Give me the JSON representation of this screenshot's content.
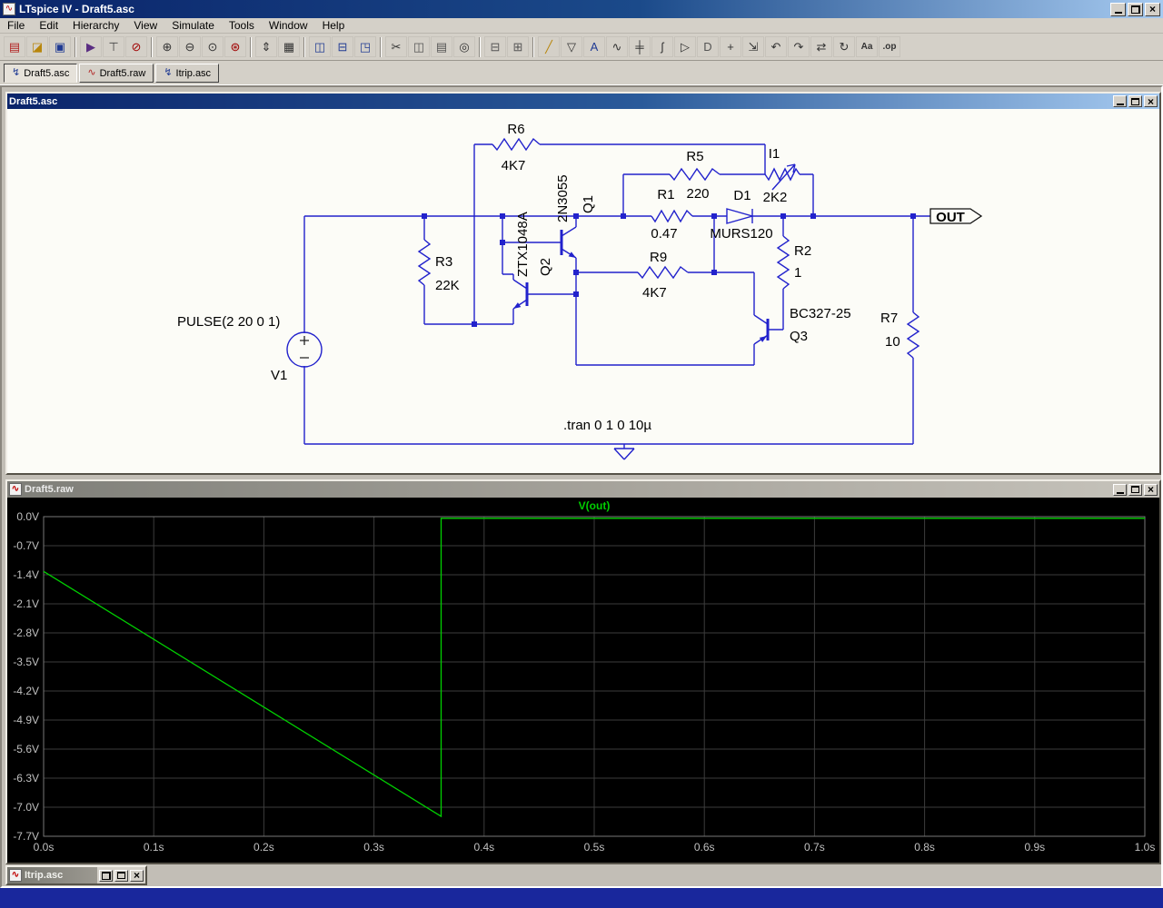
{
  "app": {
    "title": "LTspice IV - Draft5.asc"
  },
  "menu": [
    "File",
    "Edit",
    "Hierarchy",
    "View",
    "Simulate",
    "Tools",
    "Window",
    "Help"
  ],
  "toolbar": [
    {
      "name": "new-schematic",
      "glyph": "▤",
      "color": "#b22222"
    },
    {
      "name": "open-file",
      "glyph": "◪",
      "color": "#b8860b"
    },
    {
      "name": "save",
      "glyph": "▣",
      "color": "#1f3a93"
    },
    {
      "type": "sep"
    },
    {
      "name": "run",
      "glyph": "▶",
      "color": "#5a2d82"
    },
    {
      "name": "control-panel",
      "glyph": "⊤",
      "color": "#444444"
    },
    {
      "name": "halt",
      "glyph": "⊘",
      "color": "#a00000"
    },
    {
      "type": "sep"
    },
    {
      "name": "zoom-in",
      "glyph": "⊕",
      "color": "#333333"
    },
    {
      "name": "zoom-back",
      "glyph": "⊖",
      "color": "#333333"
    },
    {
      "name": "zoom-area",
      "glyph": "⊙",
      "color": "#333333"
    },
    {
      "name": "zoom-extents",
      "glyph": "⊛",
      "color": "#a00000"
    },
    {
      "type": "sep"
    },
    {
      "name": "autorange",
      "glyph": "⇕",
      "color": "#333333"
    },
    {
      "name": "plot-settings",
      "glyph": "▦",
      "color": "#333333"
    },
    {
      "type": "sep"
    },
    {
      "name": "tile-vertical",
      "glyph": "◫",
      "color": "#1f3a93"
    },
    {
      "name": "tile-horizontal",
      "glyph": "⊟",
      "color": "#1f3a93"
    },
    {
      "name": "cascade",
      "glyph": "◳",
      "color": "#1f3a93"
    },
    {
      "type": "sep"
    },
    {
      "name": "cut",
      "glyph": "✂",
      "color": "#333333"
    },
    {
      "name": "copy",
      "glyph": "◫",
      "color": "#555555"
    },
    {
      "name": "paste",
      "glyph": "▤",
      "color": "#555555"
    },
    {
      "name": "find",
      "glyph": "◎",
      "color": "#333333"
    },
    {
      "type": "sep"
    },
    {
      "name": "print",
      "glyph": "⊟",
      "color": "#555555"
    },
    {
      "name": "print-preview",
      "glyph": "⊞",
      "color": "#555555"
    },
    {
      "type": "sep"
    },
    {
      "name": "wire",
      "glyph": "╱",
      "color": "#b8860b"
    },
    {
      "name": "ground",
      "glyph": "▽",
      "color": "#333333"
    },
    {
      "name": "label-net",
      "glyph": "A",
      "color": "#1f3a93"
    },
    {
      "name": "resistor",
      "glyph": "∿",
      "color": "#333333"
    },
    {
      "name": "capacitor",
      "glyph": "╪",
      "color": "#333333"
    },
    {
      "name": "inductor",
      "glyph": "ʃ",
      "color": "#333333"
    },
    {
      "name": "diode",
      "glyph": "▷",
      "color": "#333333"
    },
    {
      "name": "component",
      "glyph": "D",
      "color": "#555555"
    },
    {
      "name": "move",
      "glyph": "+",
      "color": "#333333"
    },
    {
      "name": "drag",
      "glyph": "⇲",
      "color": "#333333"
    },
    {
      "name": "undo",
      "glyph": "↶",
      "color": "#333333"
    },
    {
      "name": "redo",
      "glyph": "↷",
      "color": "#333333"
    },
    {
      "name": "mirror",
      "glyph": "⇄",
      "color": "#333333"
    },
    {
      "name": "rotate",
      "glyph": "↻",
      "color": "#333333"
    },
    {
      "name": "text",
      "glyph": "Aa",
      "color": "#333333"
    },
    {
      "name": "spice-directive",
      "glyph": ".op",
      "color": "#333333"
    }
  ],
  "tabs": [
    {
      "label": "Draft5.asc",
      "icon": "schematic-icon",
      "glyph": "↯",
      "color": "#1f3a93",
      "active": true
    },
    {
      "label": "Draft5.raw",
      "icon": "waveform-icon",
      "glyph": "∿",
      "color": "#b22222",
      "active": false
    },
    {
      "label": "Itrip.asc",
      "icon": "schematic-icon",
      "glyph": "↯",
      "color": "#1f3a93",
      "active": false
    }
  ],
  "windows": {
    "schematic": {
      "title": "Draft5.asc"
    },
    "waveform": {
      "title": "Draft5.raw"
    },
    "minimized": {
      "title": "Itrip.asc"
    }
  },
  "schematic": {
    "directive": ".tran 0 1 0 10µ",
    "port": "OUT",
    "source": {
      "name": "V1",
      "value": "PULSE(2 20 0 1)"
    },
    "components": {
      "r6": {
        "name": "R6",
        "value": "4K7"
      },
      "r5": {
        "name": "R5",
        "value": "220"
      },
      "i1": {
        "name": "I1",
        "value": "2K2"
      },
      "r1": {
        "name": "R1",
        "value": "0.47"
      },
      "d1": {
        "name": "D1",
        "value": "MURS120"
      },
      "r3": {
        "name": "R3",
        "value": "22K"
      },
      "r2": {
        "name": "R2",
        "value": "1"
      },
      "r9": {
        "name": "R9",
        "value": "4K7"
      },
      "r7": {
        "name": "R7",
        "value": "10"
      },
      "q1": {
        "name": "Q1",
        "value": "2N3055"
      },
      "q2": {
        "name": "Q2",
        "value": "ZTX1048A"
      },
      "q3": {
        "name": "Q3",
        "value": "BC327-25"
      }
    }
  },
  "chart_data": {
    "type": "line",
    "title": "V(out)",
    "background": "#000000",
    "grid": true,
    "grid_color": "#3c3c3c",
    "frame_color": "#787878",
    "text_color": "#c0c0c0",
    "x": {
      "min": 0,
      "max": 1,
      "ticks": [
        0,
        0.1,
        0.2,
        0.3,
        0.4,
        0.5,
        0.6,
        0.7,
        0.8,
        0.9,
        1.0
      ],
      "tick_labels": [
        "0.0s",
        "0.1s",
        "0.2s",
        "0.3s",
        "0.4s",
        "0.5s",
        "0.6s",
        "0.7s",
        "0.8s",
        "0.9s",
        "1.0s"
      ]
    },
    "y": {
      "min": -7.7,
      "max": 0,
      "ticks": [
        0,
        -0.7,
        -1.4,
        -2.1,
        -2.8,
        -3.5,
        -4.2,
        -4.9,
        -5.6,
        -6.3,
        -7.0,
        -7.7
      ],
      "tick_labels": [
        "0.0V",
        "-0.7V",
        "-1.4V",
        "-2.1V",
        "-2.8V",
        "-3.5V",
        "-4.2V",
        "-4.9V",
        "-5.6V",
        "-6.3V",
        "-7.0V",
        "-7.7V"
      ]
    },
    "series": [
      {
        "name": "V(out)",
        "color": "#00d000",
        "points": [
          [
            0,
            -1.32
          ],
          [
            0.361,
            -7.22
          ],
          [
            0.361,
            -0.04
          ],
          [
            1.0,
            -0.04
          ]
        ]
      }
    ]
  }
}
